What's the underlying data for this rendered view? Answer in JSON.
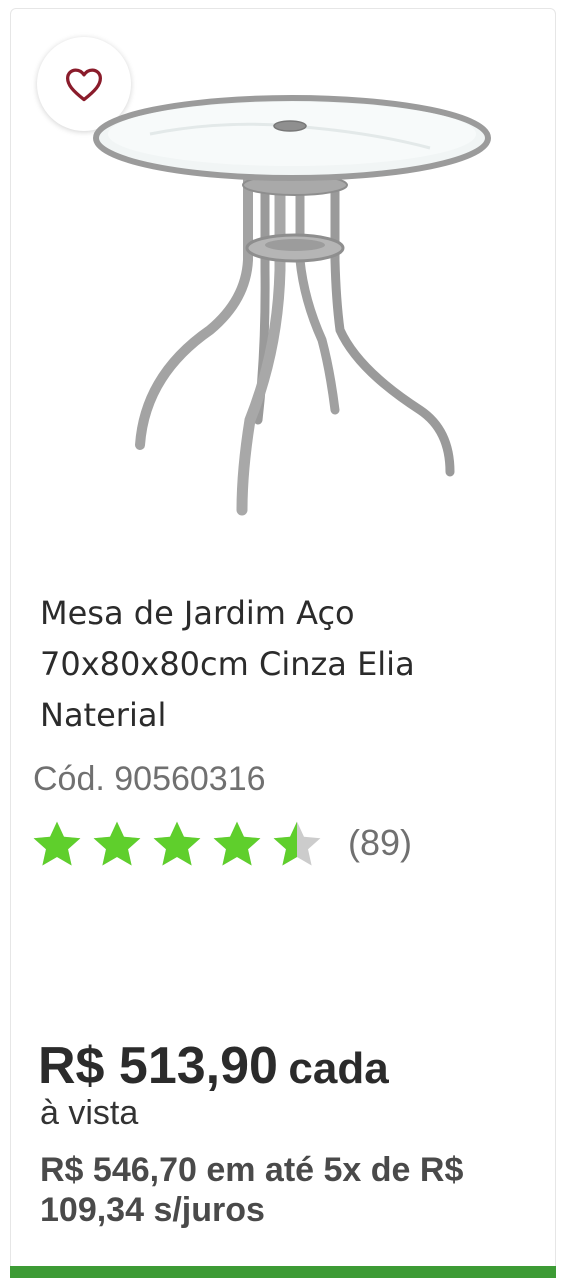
{
  "favorite": {
    "icon": "heart-icon",
    "color": "#8a1c2b"
  },
  "product": {
    "title_lines": [
      "Mesa de Jardim Aço",
      "70x80x80cm Cinza Elia",
      "Naterial"
    ],
    "code": "Cód. 90560316",
    "rating": {
      "value": 4.5,
      "max": 5,
      "review_count": "(89)",
      "star_color": "#5fcf2c",
      "empty_color": "#cccccc"
    },
    "price": {
      "value": "R$ 513,90",
      "unit": "cada"
    },
    "payment_type": "à vista",
    "installments": "R$ 546,70 em até 5x de R$ 109,34 s/juros"
  },
  "colors": {
    "accent_bar": "#3d9b35",
    "text": "#2b2b2b",
    "muted": "#707070"
  }
}
